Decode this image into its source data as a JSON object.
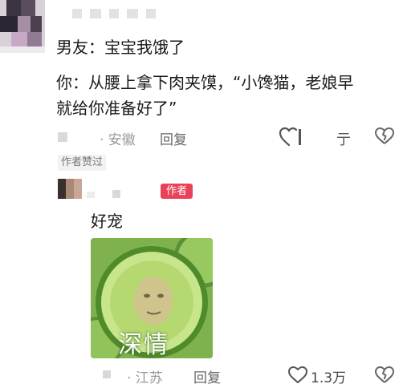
{
  "comment1": {
    "line1": "男友：宝宝我饿了",
    "line2": "你：从腰上拿下肉夹馍，“小馋猫，老娘早",
    "line3": "就给你准备好了”",
    "location": "· 安徽",
    "reply_label": "回复",
    "share_glyph": "亍",
    "liked_badge": "作者赞过"
  },
  "comment2": {
    "author_tag": "作者",
    "text": "好宠",
    "sticker_caption": "深情",
    "location": "· 江苏",
    "reply_label": "回复",
    "like_count": "1.3万"
  },
  "colors": {
    "author_tag": "#e8425a",
    "sticker_green": "#6fa846"
  },
  "icons": [
    "heart-icon",
    "broken-heart-icon",
    "share-icon"
  ]
}
